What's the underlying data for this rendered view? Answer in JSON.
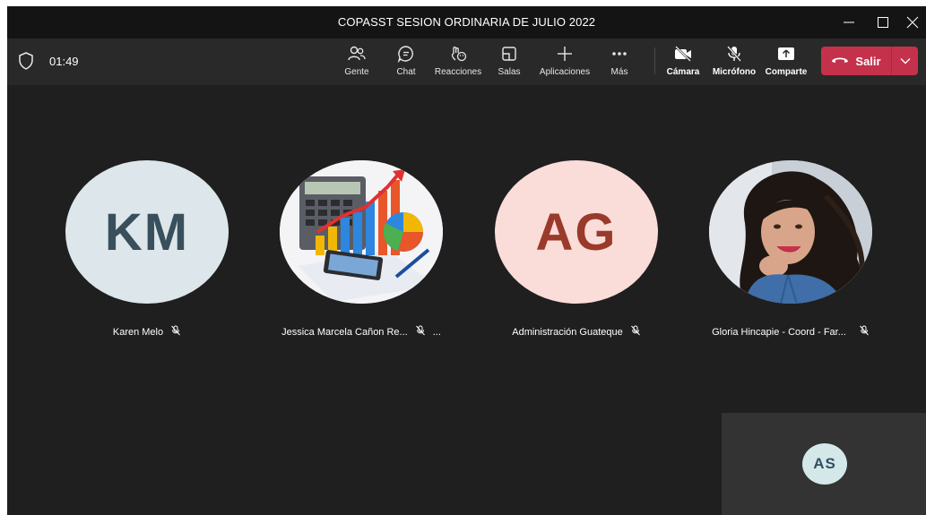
{
  "window": {
    "title": "COPASST SESION ORDINARIA DE JULIO 2022"
  },
  "toolbar": {
    "timer": "01:49",
    "buttons": [
      {
        "label": "Gente",
        "icon": "people-icon"
      },
      {
        "label": "Chat",
        "icon": "chat-icon"
      },
      {
        "label": "Reacciones",
        "icon": "reactions-icon"
      },
      {
        "label": "Salas",
        "icon": "rooms-icon"
      },
      {
        "label": "Aplicaciones",
        "icon": "add-apps-icon"
      },
      {
        "label": "Más",
        "icon": "more-icon"
      },
      {
        "label": "Cámara",
        "icon": "camera-off-icon"
      },
      {
        "label": "Micrófono",
        "icon": "mic-off-icon"
      },
      {
        "label": "Comparte",
        "icon": "share-icon"
      }
    ],
    "leave_label": "Salir",
    "leave_color": "#c4314b"
  },
  "participants": [
    {
      "initials": "KM",
      "name": "Karen Melo",
      "avatar_bg": "#dde6ea",
      "initials_color": "#3a4f5c",
      "muted": true
    },
    {
      "initials": "",
      "name": "Jessica Marcela Cañon Re...",
      "avatar_bg": "#ffffff",
      "image": "finance-charts-calculator",
      "muted": true,
      "more": "..."
    },
    {
      "initials": "AG",
      "name": "Administración Guateque",
      "avatar_bg": "#fadcd8",
      "initials_color": "#9a3a2a",
      "muted": true
    },
    {
      "initials": "",
      "name": "Gloria Hincapie - Coord - Far...",
      "avatar_bg": "#c9cfd6",
      "image": "profile-photo",
      "muted": true
    }
  ],
  "self_view": {
    "initials": "AS"
  }
}
